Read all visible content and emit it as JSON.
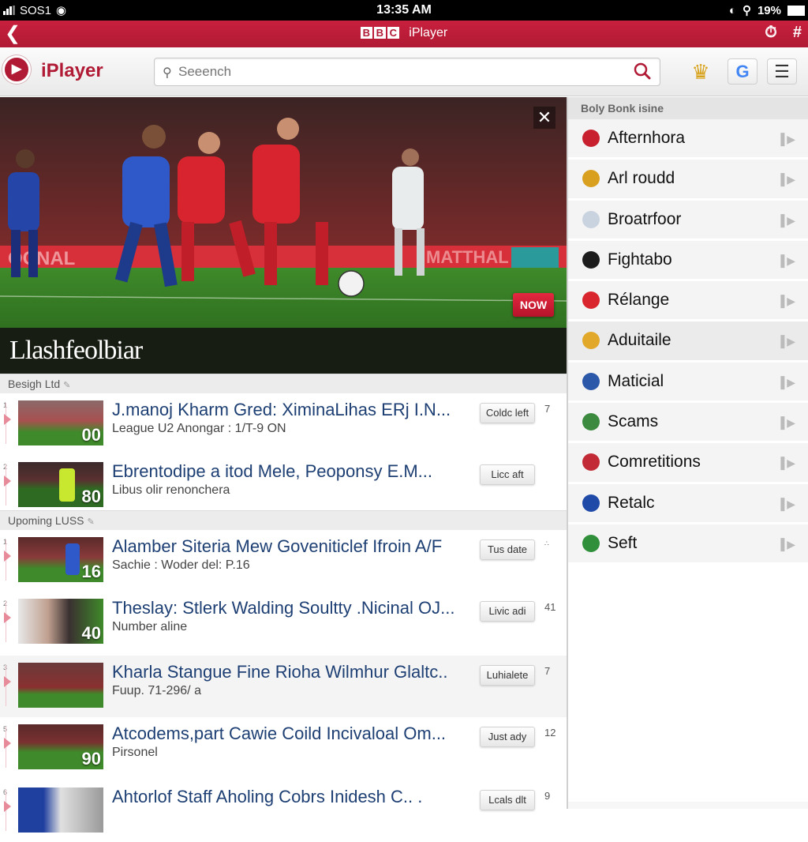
{
  "status_bar": {
    "carrier": "SOS1",
    "time": "13:35 AM",
    "battery": "19%"
  },
  "title_bar": {
    "bbc_letters": [
      "B",
      "B",
      "C"
    ],
    "app_name": "iPlayer"
  },
  "header": {
    "logo_text": "iPlayer",
    "search_placeholder": "Seeench"
  },
  "hero": {
    "badge": "NOW",
    "caption": "Llashfeolbiar",
    "close_label": "✕"
  },
  "sections": [
    {
      "heading": "Besigh Ltd",
      "items": [
        {
          "index": "1",
          "title": "J.manoj Kharm Gred: XiminaLihas ERj I.N...",
          "subtitle": "League U2 Anongar : 1/T-9 ON",
          "thumb_number": "00",
          "action": "Coldc left",
          "count": "7"
        },
        {
          "index": "2",
          "title": "Ebrentodipe a itod Mele, Peoponsy E.M...",
          "subtitle": "Libus olir renonchera",
          "thumb_number": "80",
          "action": "Licc aft",
          "count": ""
        }
      ]
    },
    {
      "heading": "Upoming LUSS",
      "items": [
        {
          "index": "1",
          "title": "Alamber Siteria Mew Goveniticlef Ifroin A/F",
          "subtitle": "Sachie : Woder del: P.16",
          "thumb_number": "16",
          "action": "Tus date",
          "count": "∴"
        },
        {
          "index": "2",
          "title": "Theslay: Stlerk Walding Soultty .Nicinal OJ...",
          "subtitle": "Number aline",
          "thumb_number": "40",
          "action": "Livic adi",
          "count": "41"
        },
        {
          "index": "3",
          "title": "Kharla Stangue Fine Rioha Wilmhur Glaltc..",
          "subtitle": "Fuup. 71-296/ a",
          "thumb_number": "",
          "action": "Luhialete",
          "count": "7"
        },
        {
          "index": "5",
          "title": "Atcodems,part Cawie Coild Incivaloal Om...",
          "subtitle": "Pirsonel",
          "thumb_number": "90",
          "action": "Just ady",
          "count": "12"
        },
        {
          "index": "6",
          "title": "Ahtorlof Staff Aholing Cobrs Inidesh C.. .",
          "subtitle": "",
          "thumb_number": "",
          "action": "Lcals dlt",
          "count": "9"
        }
      ]
    }
  ],
  "sidebar": {
    "heading": "Boly Bonk isine",
    "items": [
      {
        "label": "Afternhora",
        "crest_color": "#c8202f"
      },
      {
        "label": "Arl roudd",
        "crest_color": "#d9a020"
      },
      {
        "label": "Broatrfoor",
        "crest_color": "#c9d3e0"
      },
      {
        "label": "Fightabo",
        "crest_color": "#1c1c1c"
      },
      {
        "label": "Rélange",
        "crest_color": "#d9262e"
      },
      {
        "label": "Aduitaile",
        "crest_color": "#e2a82a"
      },
      {
        "label": "Maticial",
        "crest_color": "#2b58a8"
      },
      {
        "label": "Scams",
        "crest_color": "#3b8a40"
      },
      {
        "label": "Comretitions",
        "crest_color": "#c22a35"
      },
      {
        "label": "Retalc",
        "crest_color": "#1f4aa8"
      },
      {
        "label": "Seft",
        "crest_color": "#2f8f3a"
      }
    ]
  },
  "colors": {
    "brand_red": "#b01a34",
    "title_blue": "#1d3f73"
  }
}
